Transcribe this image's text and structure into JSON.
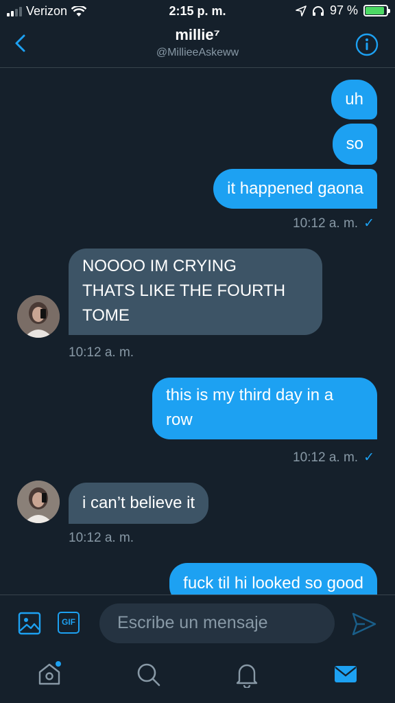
{
  "status_bar": {
    "carrier": "Verizon",
    "time": "2:15 p. m.",
    "battery_percent": "97 %",
    "battery_level": 0.97
  },
  "header": {
    "name": "millie⁷",
    "handle": "@MillieeAskeww",
    "icons": [
      "back-icon",
      "info-icon"
    ]
  },
  "messages": [
    {
      "dir": "out",
      "text": "uh"
    },
    {
      "dir": "out",
      "text": "so"
    },
    {
      "dir": "out",
      "text": "it happened gaona",
      "time": "10:12 a. m.",
      "read": "✓"
    },
    {
      "dir": "in",
      "lines": [
        "NOOOO IM CRYING",
        "THATS LIKE THE FOURTH",
        "TOME"
      ],
      "time": "10:12 a. m."
    },
    {
      "dir": "out",
      "lines": [
        "this is my third day in a",
        "row"
      ],
      "time": "10:12 a. m.",
      "read": "✓"
    },
    {
      "dir": "in",
      "text": "i can’t believe it",
      "time": "10:12 a. m."
    },
    {
      "dir": "out",
      "text": "fuck til hi looked so good"
    }
  ],
  "composer": {
    "gif_label": "GIF",
    "placeholder": "Escribe un mensaje",
    "icons": [
      "image-icon",
      "gif-icon",
      "send-icon"
    ]
  },
  "tab_bar": {
    "icons": [
      "home-icon",
      "search-icon",
      "notifications-icon",
      "messages-icon"
    ],
    "active": "messages-icon"
  },
  "colors": {
    "background": "#15202b",
    "accent": "#1da1f2",
    "incoming_bubble": "#3d5466",
    "muted_text": "#8899a6"
  }
}
